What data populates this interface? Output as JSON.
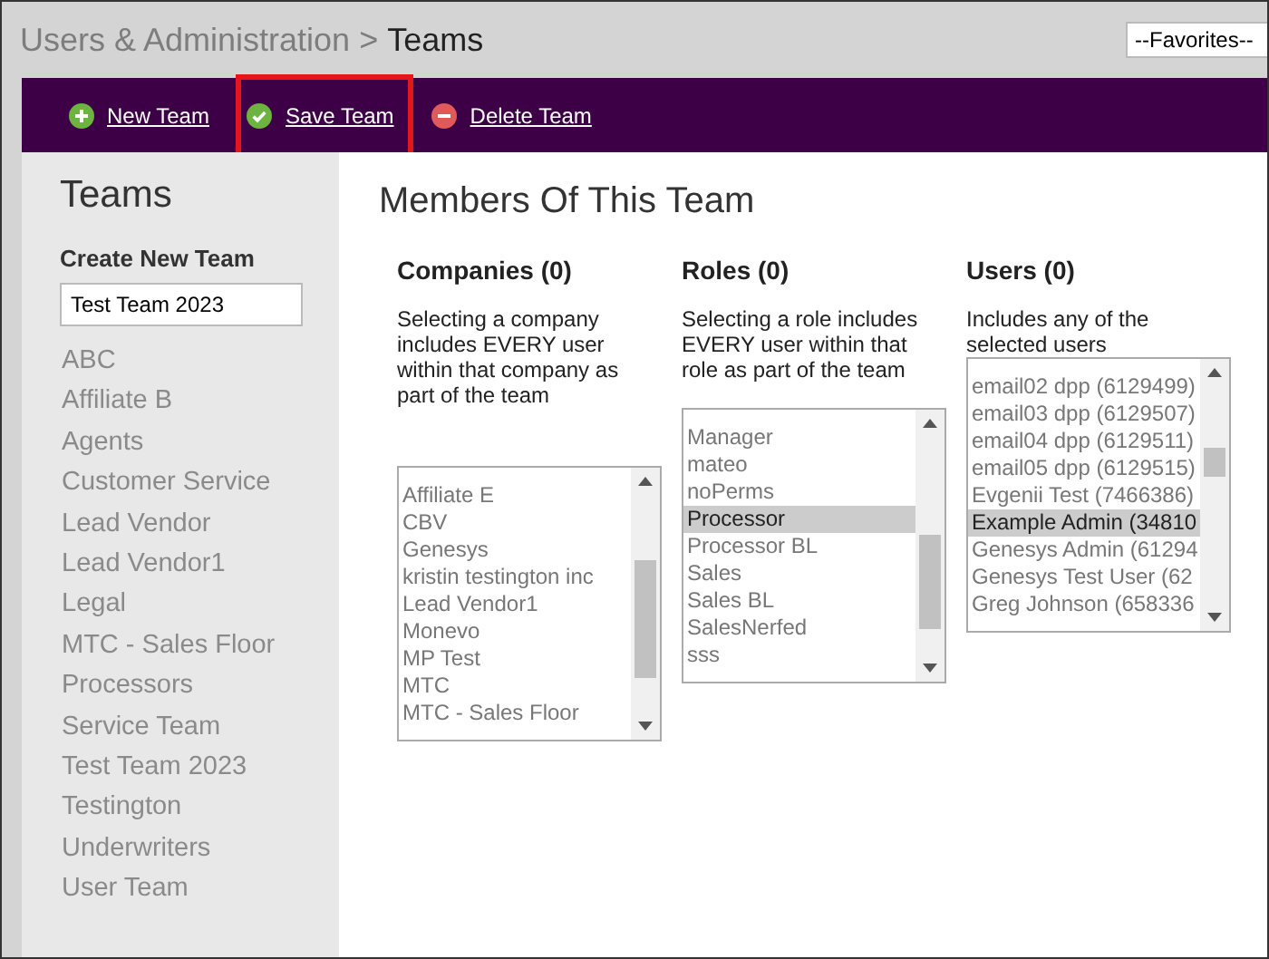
{
  "header": {
    "breadcrumb_parent": "Users & Administration",
    "separator": ">",
    "breadcrumb_current": "Teams",
    "favorites_select": "--Favorites--"
  },
  "toolbar": [
    {
      "kind": "add",
      "label": "New Team",
      "highlighted": false
    },
    {
      "kind": "save",
      "label": "Save Team",
      "highlighted": true
    },
    {
      "kind": "delete",
      "label": "Delete Team",
      "highlighted": false
    }
  ],
  "sidebar": {
    "title": "Teams",
    "create_label": "Create New Team",
    "create_input": "Test Team 2023",
    "items": [
      "ABC",
      "Affiliate B",
      "Agents",
      "Customer Service",
      "Lead Vendor",
      "Lead Vendor1",
      "Legal",
      "MTC - Sales Floor",
      "Processors",
      "Service Team",
      "Test Team 2023",
      "Testington",
      "Underwriters",
      "User Team"
    ]
  },
  "main": {
    "title": "Members Of This Team",
    "panels": [
      {
        "heading": "Companies (0)",
        "description": "Selecting a company includes EVERY user within that company as part of the team",
        "options": [
          {
            "label": "Affiliate E",
            "selected": false
          },
          {
            "label": "CBV",
            "selected": false
          },
          {
            "label": "Genesys",
            "selected": false
          },
          {
            "label": "kristin testington inc",
            "selected": false
          },
          {
            "label": "Lead Vendor1",
            "selected": false
          },
          {
            "label": "Monevo",
            "selected": false
          },
          {
            "label": "MP Test",
            "selected": false
          },
          {
            "label": "MTC",
            "selected": false
          },
          {
            "label": "MTC - Sales Floor",
            "selected": false
          }
        ]
      },
      {
        "heading": "Roles (0)",
        "description": "Selecting a role includes EVERY user within that role as part of the team",
        "options": [
          {
            "label": "Manager",
            "selected": false
          },
          {
            "label": "mateo",
            "selected": false
          },
          {
            "label": "noPerms",
            "selected": false
          },
          {
            "label": "Processor",
            "selected": true
          },
          {
            "label": "Processor BL",
            "selected": false
          },
          {
            "label": "Sales",
            "selected": false
          },
          {
            "label": "Sales BL",
            "selected": false
          },
          {
            "label": "SalesNerfed",
            "selected": false
          },
          {
            "label": "sss",
            "selected": false
          }
        ]
      },
      {
        "heading": "Users (0)",
        "description": "Includes any of the selected users",
        "options": [
          {
            "label": "email02 dpp (6129499)",
            "selected": false
          },
          {
            "label": "email03 dpp (6129507)",
            "selected": false
          },
          {
            "label": "email04 dpp (6129511)",
            "selected": false
          },
          {
            "label": "email05 dpp (6129515)",
            "selected": false
          },
          {
            "label": "Evgenii Test (7466386)",
            "selected": false
          },
          {
            "label": "Example Admin (34810",
            "selected": true
          },
          {
            "label": "Genesys Admin (61294",
            "selected": false
          },
          {
            "label": "Genesys Test User (62",
            "selected": false
          },
          {
            "label": "Greg Johnson (658336",
            "selected": false
          }
        ]
      }
    ]
  }
}
